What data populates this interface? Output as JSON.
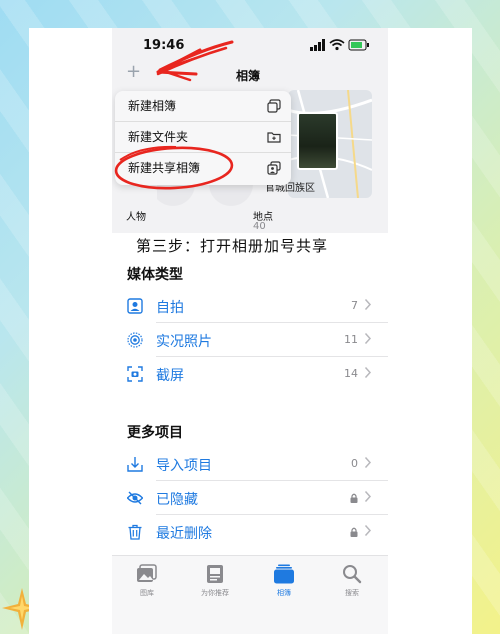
{
  "status": {
    "time": "19:46"
  },
  "nav": {
    "add_symbol": "+",
    "title": "相簿"
  },
  "menu": {
    "items": [
      {
        "label": "新建相簿",
        "icon": "album-add-icon"
      },
      {
        "label": "新建文件夹",
        "icon": "folder-add-icon"
      },
      {
        "label": "新建共享相簿",
        "icon": "shared-album-add-icon"
      }
    ]
  },
  "albums": {
    "people": {
      "name": "人物",
      "count": ""
    },
    "places": {
      "name": "地点",
      "count": "40",
      "map_label": "官城回族区"
    }
  },
  "caption": "第三步：打开相册加号共享",
  "media_types": {
    "title": "媒体类型",
    "items": [
      {
        "label": "自拍",
        "count": "7",
        "icon": "selfie-icon"
      },
      {
        "label": "实况照片",
        "count": "11",
        "icon": "live-photo-icon"
      },
      {
        "label": "截屏",
        "count": "14",
        "icon": "screenshot-icon"
      }
    ]
  },
  "more": {
    "title": "更多项目",
    "items": [
      {
        "label": "导入项目",
        "count": "0",
        "icon": "import-icon"
      },
      {
        "label": "已隐藏",
        "count": "",
        "icon": "eye-hidden-icon"
      },
      {
        "label": "最近删除",
        "count": "",
        "icon": "trash-icon"
      }
    ]
  },
  "tabs": [
    {
      "label": "图库",
      "icon": "library-icon",
      "active": false
    },
    {
      "label": "为你推荐",
      "icon": "for-you-icon",
      "active": false
    },
    {
      "label": "相簿",
      "icon": "albums-icon",
      "active": true
    },
    {
      "label": "搜索",
      "icon": "search-icon",
      "active": false
    }
  ],
  "colors": {
    "accent": "#1f7ae0",
    "annotation": "#e8261f"
  }
}
